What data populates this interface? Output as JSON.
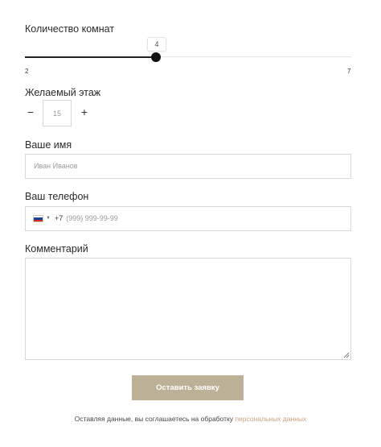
{
  "rooms": {
    "label": "Количество комнат",
    "value": "4",
    "min": "2",
    "max": "7"
  },
  "floor": {
    "label": "Желаемый этаж",
    "minus": "−",
    "plus": "+",
    "value": "15"
  },
  "name": {
    "label": "Ваше имя",
    "placeholder": "Иван Иванов"
  },
  "phone": {
    "label": "Ваш телефон",
    "country_icon": "russia-flag-icon",
    "dial_code": "+7",
    "placeholder": "(999) 999-99-99"
  },
  "comment": {
    "label": "Комментарий"
  },
  "submit": {
    "label": "Оставить заявку"
  },
  "consent": {
    "text": "Оставляя данные, вы соглашаетесь на обработку",
    "link": "персональных данных"
  },
  "colors": {
    "button_bg": "#bcb197",
    "link": "#c9a27c",
    "border": "#d8d8d8"
  }
}
